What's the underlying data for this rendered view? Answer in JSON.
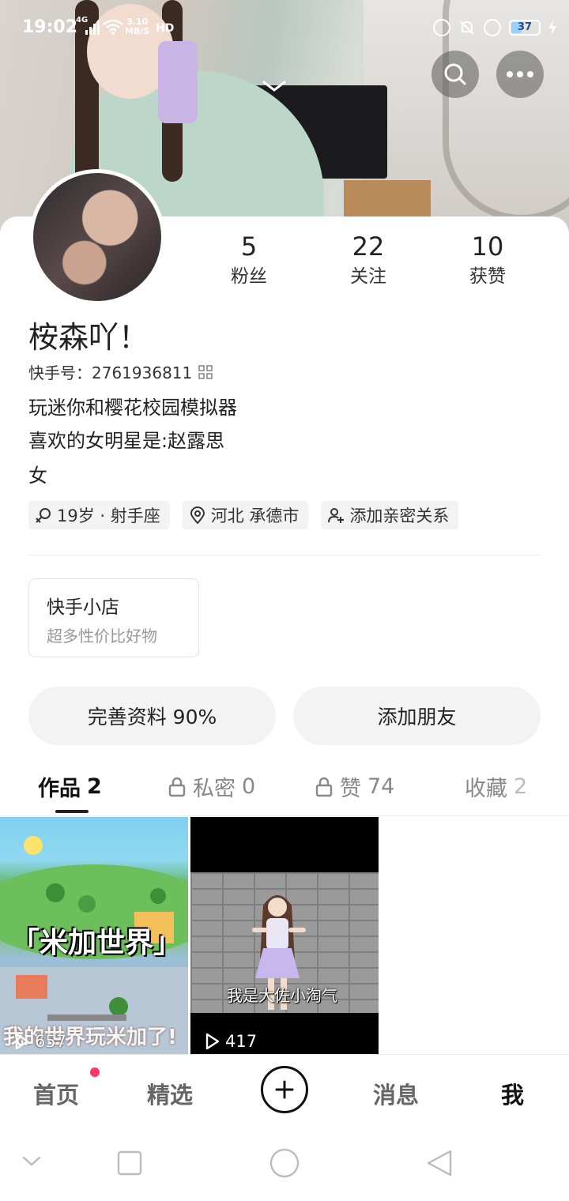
{
  "status_bar": {
    "time": "19:02",
    "network": "4G",
    "speed_value": "3.10",
    "speed_unit": "MB/S",
    "hd": "HD",
    "battery": "37",
    "battery_level": 0.37
  },
  "header": {
    "search_icon": "search-icon",
    "more_icon": "more-icon",
    "collapse_icon": "chevron-down-icon"
  },
  "profile": {
    "stats": [
      {
        "value": "5",
        "label": "粉丝"
      },
      {
        "value": "22",
        "label": "关注"
      },
      {
        "value": "10",
        "label": "获赞"
      }
    ],
    "nickname": "桉森吖！",
    "kuaishou_id": "快手号：2761936811",
    "bio_lines": [
      "玩迷你和樱花校园模拟器",
      "喜欢的女明星是:赵露思",
      "女"
    ],
    "tags": [
      {
        "icon": "female-icon",
        "text": "19岁 · 射手座"
      },
      {
        "icon": "location-pin-icon",
        "text": "河北 承德市"
      },
      {
        "icon": "add-person-icon",
        "text": "添加亲密关系"
      }
    ]
  },
  "shop": {
    "title": "快手小店",
    "subtitle": "超多性价比好物"
  },
  "actions": {
    "complete_profile": "完善资料 90%",
    "add_friend": "添加朋友"
  },
  "tabs": [
    {
      "label": "作品",
      "count": "2",
      "locked": false
    },
    {
      "label": "私密",
      "count": "0",
      "locked": true
    },
    {
      "label": "赞",
      "count": "74",
      "locked": true
    },
    {
      "label": "收藏",
      "count": "2",
      "locked": false
    }
  ],
  "videos": [
    {
      "title": "「米加世界」",
      "caption": "我的世界玩米加了!",
      "plays": "657"
    },
    {
      "caption": "我是大佐小淘气",
      "plays": "417"
    }
  ],
  "bottom_nav": {
    "home": "首页",
    "featured": "精选",
    "messages": "消息",
    "me": "我"
  },
  "colors": {
    "accent": "#fe3666",
    "text": "#222222",
    "muted": "#999999",
    "chip_bg": "#f3f3f3"
  }
}
